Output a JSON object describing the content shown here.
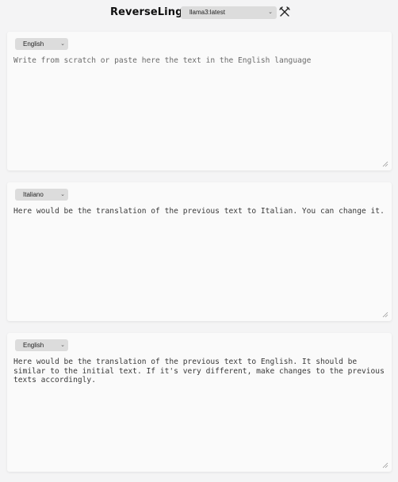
{
  "app": {
    "title": "ReverseLingo",
    "model_selected": "llama3:latest",
    "tools_icon": "tools-icon"
  },
  "panels": [
    {
      "language": "English",
      "placeholder": "Write from scratch or paste here the text in the English language",
      "value": ""
    },
    {
      "language": "Italiano",
      "placeholder": "",
      "value": "Here would be the translation of the previous text to Italian. You can change it."
    },
    {
      "language": "English",
      "placeholder": "",
      "value": "Here would be the translation of the previous text to English. It should be\nsimilar to the initial text. If it's very different, make changes to the previous\ntexts accordingly."
    }
  ]
}
